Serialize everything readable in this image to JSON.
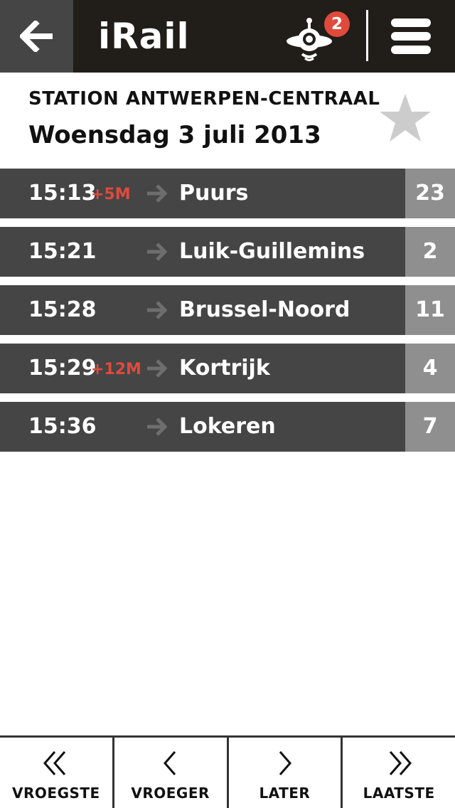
{
  "app": {
    "title": "iRail",
    "notification_count": "2"
  },
  "header": {
    "station": "STATION ANTWERPEN-CENTRAAL",
    "date": "Woensdag 3 juli 2013",
    "favorite": false
  },
  "departures": [
    {
      "time": "15:13",
      "delay": "+5M",
      "destination": "Puurs",
      "platform": "23"
    },
    {
      "time": "15:21",
      "delay": "",
      "destination": "Luik-Guillemins",
      "platform": "2"
    },
    {
      "time": "15:28",
      "delay": "",
      "destination": "Brussel-Noord",
      "platform": "11"
    },
    {
      "time": "15:29",
      "delay": "+12M",
      "destination": "Kortrijk",
      "platform": "4"
    },
    {
      "time": "15:36",
      "delay": "",
      "destination": "Lokeren",
      "platform": "7"
    }
  ],
  "nav": {
    "earliest": "VROEGSTE",
    "earlier": "VROEGER",
    "later": "LATER",
    "latest": "LAATSTE"
  },
  "colors": {
    "topbar": "#211d18",
    "row": "#454545",
    "platform": "#8f8f8f",
    "delay": "#e04a3c",
    "badge": "#e04a3c"
  }
}
